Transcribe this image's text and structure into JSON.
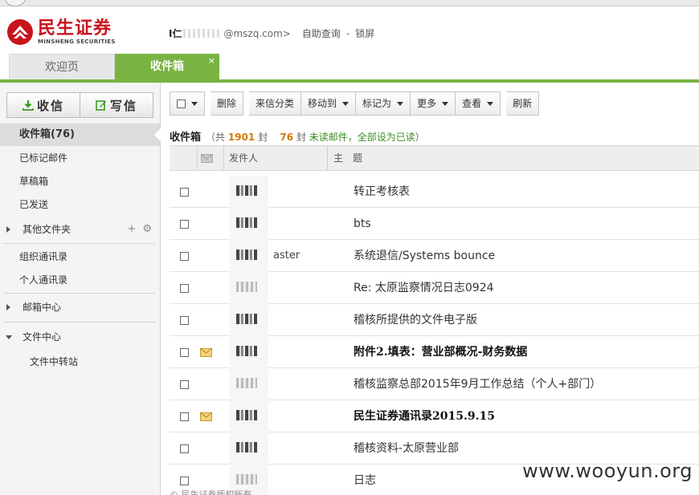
{
  "header": {
    "logo_cn": "民生证券",
    "logo_en": "MINSHENG SECURITIES",
    "user_name": "I仁",
    "user_mail": "@mszq.com>",
    "self_query": "自助查询",
    "separator": "-",
    "lock": "锁屏"
  },
  "tabs": {
    "welcome": "欢迎页",
    "inbox": "收件箱",
    "close": "×"
  },
  "sidebar": {
    "receive": "收信",
    "compose": "写信",
    "folders": {
      "inbox": "收件箱(76)",
      "flagged": "已标记邮件",
      "drafts": "草稿箱",
      "sent": "已发送",
      "other": "其他文件夹",
      "org_contacts": "组织通讯录",
      "personal_contacts": "个人通讯录",
      "mailbox_center": "邮箱中心",
      "file_center": "文件中心",
      "file_transfer": "文件中转站"
    },
    "add": "+",
    "settings": "⚙"
  },
  "toolbar": {
    "delete": "删除",
    "classify": "来信分类",
    "move_to": "移动到",
    "mark_as": "标记为",
    "more": "更多",
    "view": "查看",
    "refresh": "刷新"
  },
  "summary": {
    "title": "收件箱",
    "open": "（共",
    "total": "1901",
    "unit": "封",
    "unread_count": "76",
    "unread_label": "封",
    "unread_link": "未读邮件",
    "mark_all": "，全部设为已读",
    "close": "）"
  },
  "columns": {
    "sender": "发件人",
    "subject": "主　题"
  },
  "emails": [
    {
      "sender_tail": "",
      "subject": "转正考核表",
      "unread": false
    },
    {
      "sender_tail": "",
      "subject": "bts",
      "unread": false
    },
    {
      "sender_tail": "aster",
      "subject": "系统退信/Systems bounce",
      "unread": false
    },
    {
      "sender_tail": "",
      "subject": "Re: 太原监察情况日志0924",
      "unread": false
    },
    {
      "sender_tail": "",
      "subject": "稽核所提供的文件电子版",
      "unread": false
    },
    {
      "sender_tail": "",
      "subject": "附件2.填表：营业部概况-财务数据",
      "unread": true
    },
    {
      "sender_tail": "",
      "subject": "稽核监察总部2015年9月工作总结（个人+部门）",
      "unread": false
    },
    {
      "sender_tail": "",
      "subject": "民生证券通讯录2015.9.15",
      "unread": true
    },
    {
      "sender_tail": "",
      "subject": "稽核资料-太原营业部",
      "unread": false
    },
    {
      "sender_tail": "",
      "subject": "日志",
      "unread": false
    }
  ],
  "footer": "© 民生证券版权所有",
  "watermark": "www.wooyun.org",
  "colors": {
    "brand_red": "#c8141c",
    "accent_green": "#79b342",
    "count_orange": "#d67a00"
  }
}
